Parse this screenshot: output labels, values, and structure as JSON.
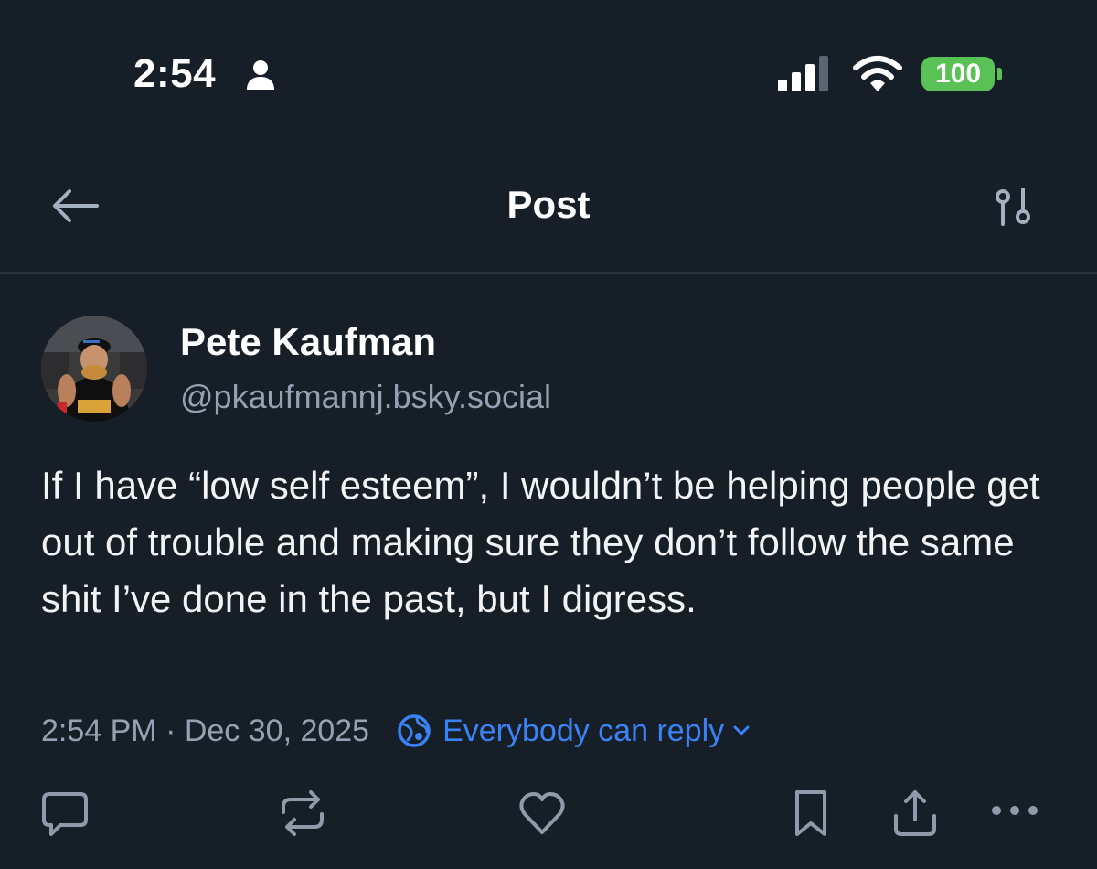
{
  "status_bar": {
    "time": "2:54",
    "battery": "100",
    "battery_color": "#5ac156"
  },
  "header": {
    "title": "Post",
    "back_icon": "arrow-left-icon",
    "settings_icon": "sliders-icon"
  },
  "post": {
    "author_name": "Pete Kaufman",
    "author_handle": "@pkaufmannj.bsky.social",
    "text": "If I have “low self esteem”, I wouldn’t be helping people get out of trouble and making sure they don’t follow the same shit I’ve done in the past, but I digress.",
    "timestamp": "2:54 PM · Dec 30, 2025",
    "reply_setting": "Everybody can reply"
  },
  "actions": [
    {
      "icon": "reply-icon"
    },
    {
      "icon": "repost-icon"
    },
    {
      "icon": "like-icon"
    },
    {
      "icon": "bookmark-icon"
    },
    {
      "icon": "share-icon"
    },
    {
      "icon": "more-icon"
    }
  ],
  "colors": {
    "background": "#161e27",
    "accent": "#3a83f7",
    "muted_text": "#94a1b2"
  }
}
